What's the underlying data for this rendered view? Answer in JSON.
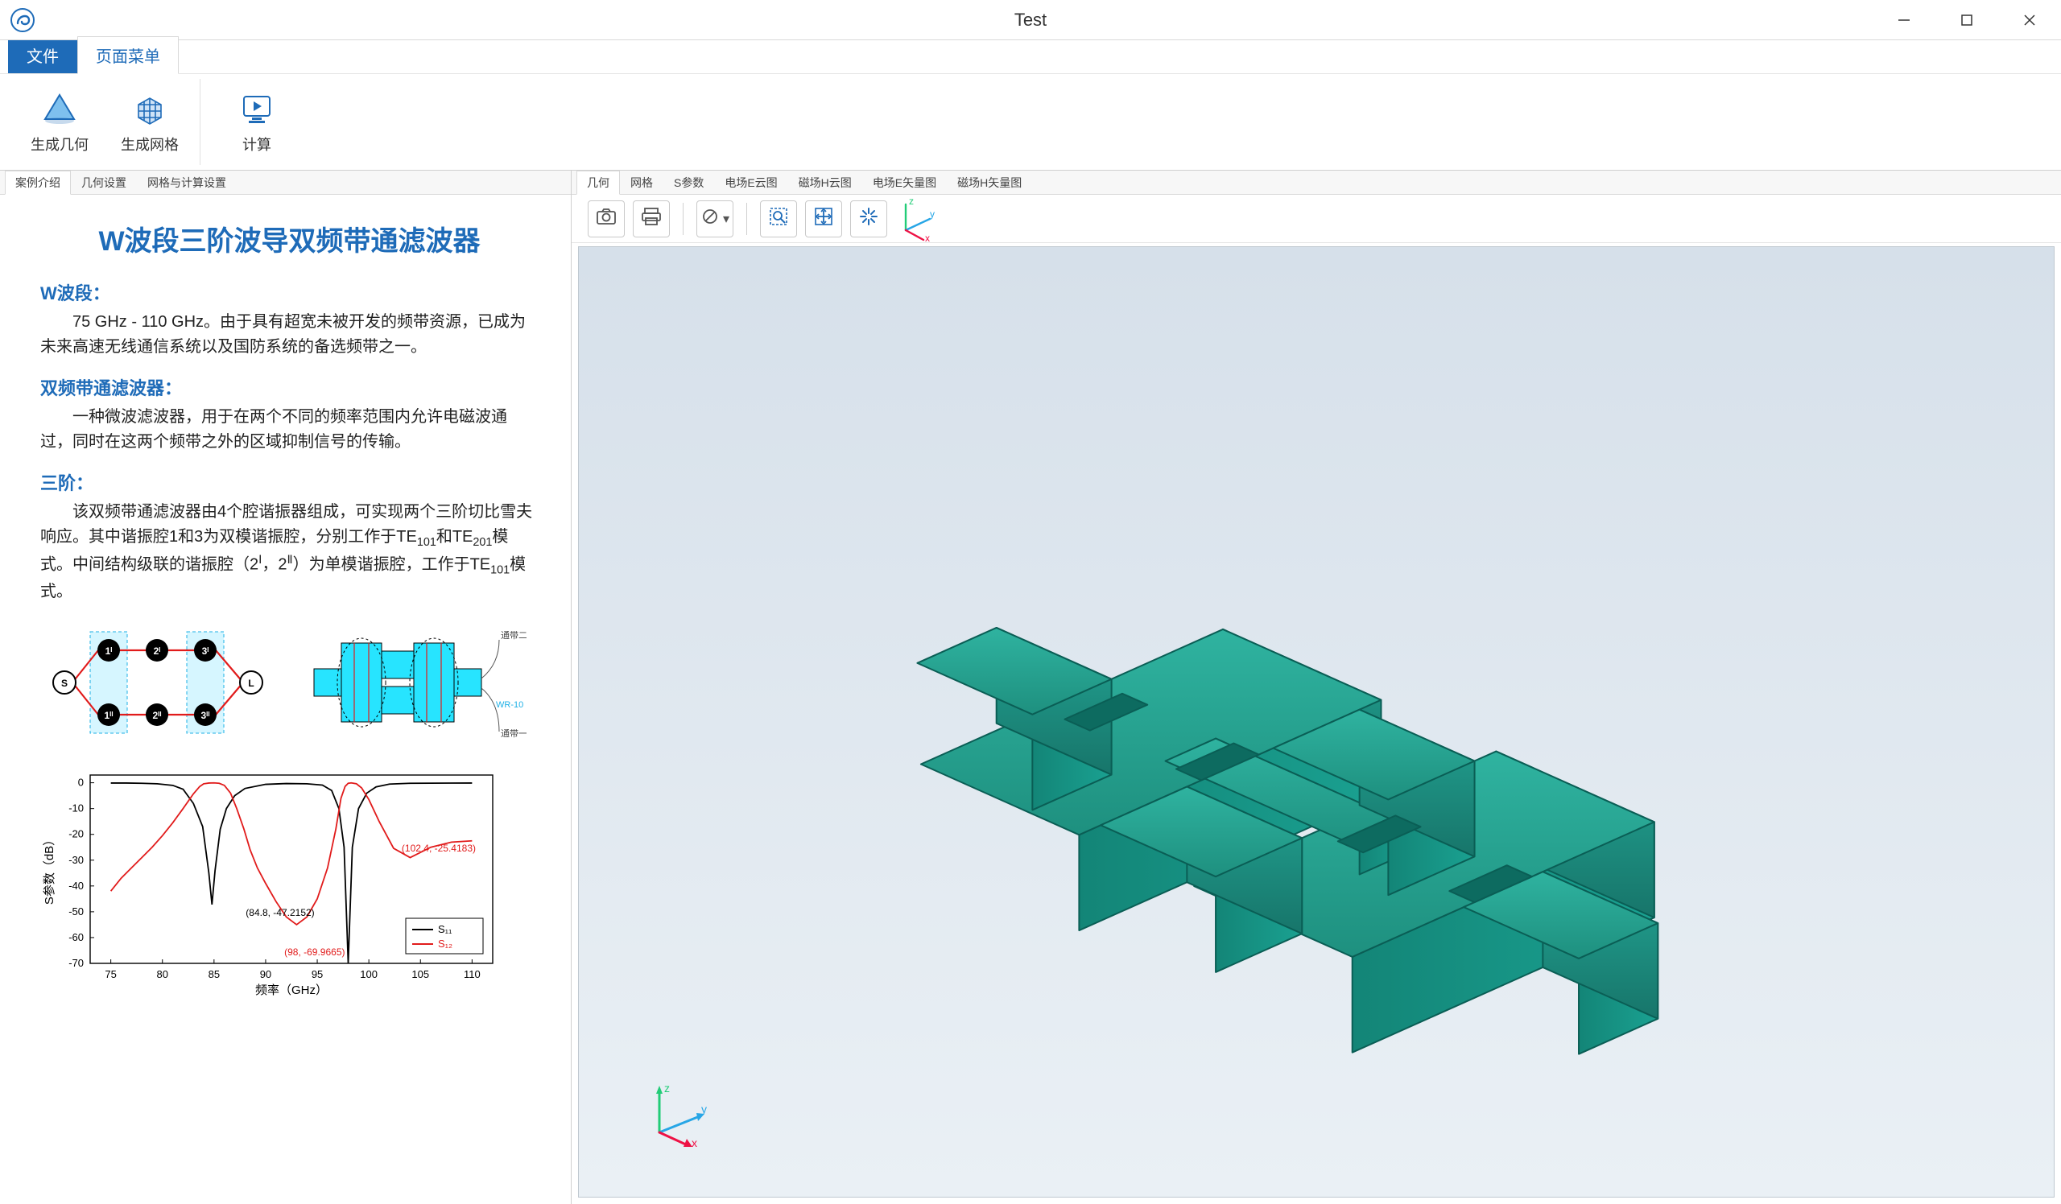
{
  "window": {
    "title": "Test"
  },
  "menu": {
    "file": "文件",
    "page": "页面菜单"
  },
  "ribbon": {
    "gen_geom": "生成几何",
    "gen_mesh": "生成网格",
    "compute": "计算"
  },
  "left_tabs": {
    "intro": "案例介绍",
    "geom": "几何设置",
    "mesh_calc": "网格与计算设置"
  },
  "right_tabs": {
    "geom": "几何",
    "mesh": "网格",
    "sparam": "S参数",
    "ecloud": "电场E云图",
    "hcloud": "磁场H云图",
    "evec": "电场E矢量图",
    "hvec": "磁场H矢量图"
  },
  "article": {
    "title": "W波段三阶波导双频带通滤波器",
    "h_wband": "W波段：",
    "p_wband": "75 GHz - 110 GHz。由于具有超宽未被开发的频带资源，已成为未来高速无线通信系统以及国防系统的备选频带之一。",
    "h_dual": "双频带通滤波器：",
    "p_dual": "一种微波滤波器，用于在两个不同的频率范围内允许电磁波通过，同时在这两个频带之外的区域抑制信号的传输。",
    "h_order": "三阶：",
    "p_order_1": "该双频带通滤波器由4个腔谐振器组成，可实现两个三阶切比雪夫响应。其中谐振腔1和3为双模谐振腔，分别工作于TE",
    "p_order_sub1": "101",
    "p_order_mid1": "和TE",
    "p_order_sub2": "201",
    "p_order_mid2": "模式。中间结构级联的谐振腔（2",
    "p_order_sup1": "Ⅰ",
    "p_order_mid3": "，2",
    "p_order_sup2": "Ⅱ",
    "p_order_2": "）为单模谐振腔，工作于TE",
    "p_order_sub3": "101",
    "p_order_end": "模式。"
  },
  "network": {
    "S": "S",
    "L": "L",
    "n1a": "1ᴵ",
    "n2a": "2ᴵ",
    "n3a": "3ᴵ",
    "n1b": "1ᴵᴵ",
    "n2b": "2ᴵᴵ",
    "n3b": "3ᴵᴵ",
    "band1": "通带一",
    "band2": "通带二",
    "wr": "WR-10"
  },
  "chart_data": {
    "type": "line",
    "title": "",
    "xlabel": "频率（GHz）",
    "ylabel": "S参数（dB）",
    "xlim": [
      73,
      112
    ],
    "ylim": [
      -70,
      3
    ],
    "xticks": [
      75,
      80,
      85,
      90,
      95,
      100,
      105,
      110
    ],
    "yticks": [
      0,
      -10,
      -20,
      -30,
      -40,
      -50,
      -60,
      -70
    ],
    "series": [
      {
        "name": "S11",
        "color": "#000000",
        "points": [
          [
            75,
            -0.1
          ],
          [
            76.5,
            -0.1
          ],
          [
            78,
            -0.2
          ],
          [
            79.5,
            -0.4
          ],
          [
            81,
            -1
          ],
          [
            82,
            -2.5
          ],
          [
            83,
            -8
          ],
          [
            83.9,
            -17
          ],
          [
            84.5,
            -35
          ],
          [
            84.8,
            -47.2152
          ],
          [
            85.1,
            -34
          ],
          [
            85.6,
            -18
          ],
          [
            86.2,
            -10
          ],
          [
            87,
            -5
          ],
          [
            88,
            -2.2
          ],
          [
            90,
            -0.6
          ],
          [
            92,
            -0.3
          ],
          [
            94,
            -0.4
          ],
          [
            95.5,
            -0.9
          ],
          [
            96.4,
            -3
          ],
          [
            97.1,
            -10
          ],
          [
            97.6,
            -25
          ],
          [
            98,
            -69.9665
          ],
          [
            98.4,
            -25
          ],
          [
            99,
            -10
          ],
          [
            99.8,
            -4
          ],
          [
            100.7,
            -1.6
          ],
          [
            102,
            -0.5
          ],
          [
            104,
            -0.2
          ],
          [
            106,
            -0.15
          ],
          [
            108,
            -0.12
          ],
          [
            110,
            -0.1
          ]
        ]
      },
      {
        "name": "S12",
        "color": "#E11B1B",
        "points": [
          [
            75,
            -42
          ],
          [
            76,
            -37
          ],
          [
            77,
            -33
          ],
          [
            78,
            -29
          ],
          [
            79,
            -25
          ],
          [
            80,
            -20.5
          ],
          [
            81,
            -15.5
          ],
          [
            82,
            -10
          ],
          [
            83,
            -4.3
          ],
          [
            83.6,
            -1.5
          ],
          [
            84,
            -0.4
          ],
          [
            84.5,
            -0.1
          ],
          [
            85,
            -0.05
          ],
          [
            85.5,
            -0.2
          ],
          [
            86,
            -1
          ],
          [
            86.6,
            -4
          ],
          [
            87.2,
            -10
          ],
          [
            87.9,
            -18
          ],
          [
            88.5,
            -26
          ],
          [
            89.2,
            -33
          ],
          [
            90,
            -39
          ],
          [
            91,
            -46
          ],
          [
            92,
            -52
          ],
          [
            93,
            -55
          ],
          [
            94,
            -52
          ],
          [
            95,
            -45
          ],
          [
            96,
            -33
          ],
          [
            96.8,
            -18
          ],
          [
            97.3,
            -6
          ],
          [
            97.7,
            -1.4
          ],
          [
            98,
            -0.2
          ],
          [
            98.3,
            -0.05
          ],
          [
            98.8,
            -0.4
          ],
          [
            99.3,
            -2
          ],
          [
            100,
            -6.5
          ],
          [
            101,
            -15
          ],
          [
            102.4,
            -25.4183
          ],
          [
            104,
            -29
          ],
          [
            106,
            -25
          ],
          [
            108,
            -23
          ],
          [
            110,
            -22.5
          ]
        ]
      }
    ],
    "annotations": [
      {
        "text": "(84.8, -47.2152)",
        "x": 84.8,
        "y": -47.2152,
        "dx": 42,
        "dy": 14,
        "color": "#000"
      },
      {
        "text": "(98, -69.9665)",
        "x": 98,
        "y": -69.9665,
        "dx": -4,
        "dy": -10,
        "anchor": "end",
        "color": "#E11B1B"
      },
      {
        "text": "(102.4, -25.4183)",
        "x": 102.4,
        "y": -25.4183,
        "dx": 10,
        "dy": 4,
        "color": "#E11B1B"
      }
    ],
    "legend": {
      "s11": "S₁₁",
      "s12": "S₁₂"
    }
  }
}
